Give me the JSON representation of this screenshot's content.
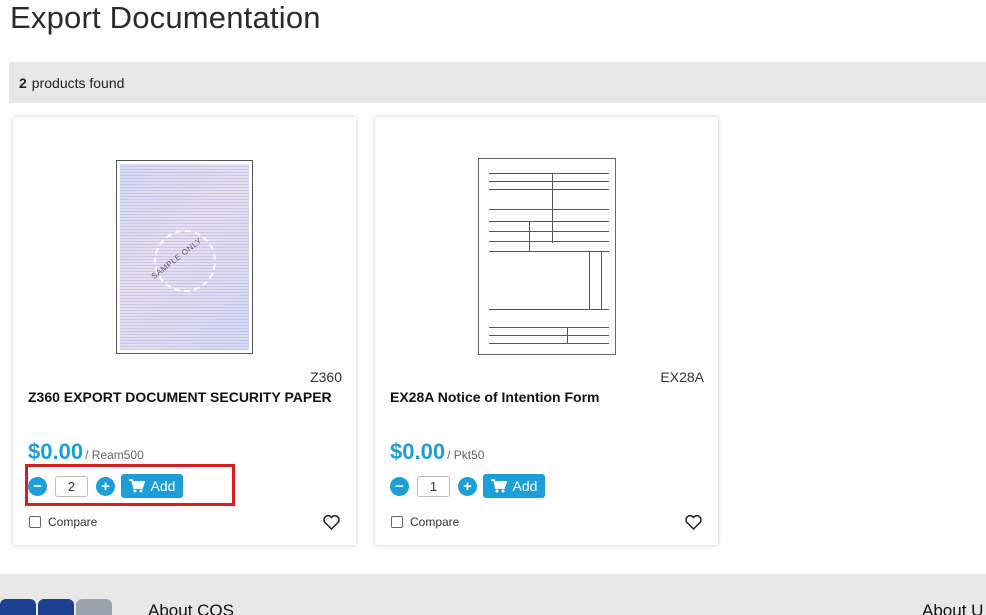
{
  "page": {
    "title": "Export Documentation"
  },
  "results": {
    "count": "2",
    "label": "products found"
  },
  "products": [
    {
      "sku": "Z360",
      "name": "Z360 EXPORT DOCUMENT SECURITY PAPER",
      "price": "$0.00",
      "unit": "/ Ream500",
      "quantity": "2",
      "minus_label": "−",
      "plus_label": "+",
      "add_label": "Add",
      "compare_label": "Compare",
      "image_watermark": "SAMPLE ONLY",
      "highlighted": true
    },
    {
      "sku": "EX28A",
      "name": "EX28A Notice of Intention Form",
      "price": "$0.00",
      "unit": "/ Pkt50",
      "quantity": "1",
      "minus_label": "−",
      "plus_label": "+",
      "add_label": "Add",
      "compare_label": "Compare",
      "highlighted": false
    }
  ],
  "footer": {
    "about_left": "About COS",
    "about_right": "About U"
  },
  "colors": {
    "accent": "#1c9fd8",
    "highlight": "#d42020",
    "bar_bg": "#e8e8e8"
  },
  "icons": [
    "cart-icon",
    "heart-icon",
    "minus-icon",
    "plus-icon"
  ]
}
